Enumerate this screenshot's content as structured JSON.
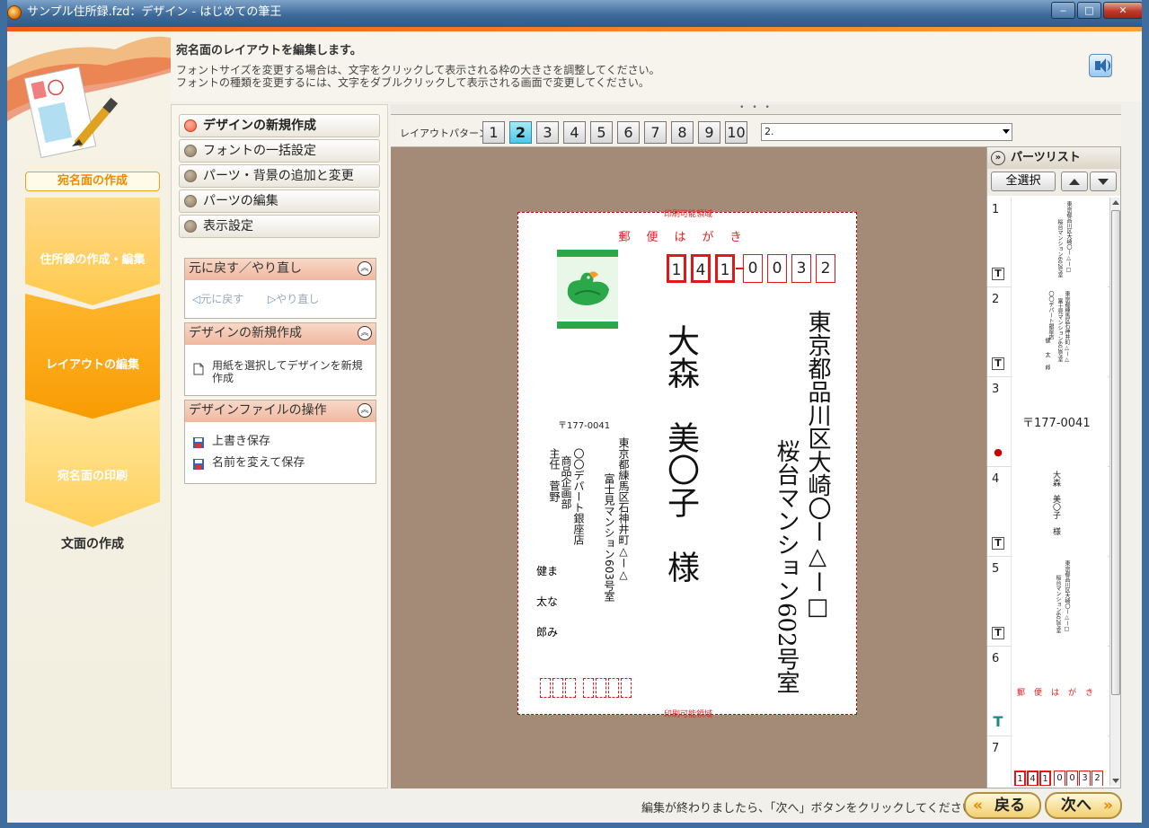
{
  "window": {
    "title": "サンプル住所録.fzd：デザイン - はじめての筆王",
    "controls": {
      "minimize": "‒",
      "maximize": "□",
      "close": "✕"
    }
  },
  "nav": {
    "current_label": "宛名面の作成",
    "items": [
      {
        "label": "住所録の作成・編集"
      },
      {
        "label": "レイアウトの編集"
      },
      {
        "label": "宛名面の印刷"
      },
      {
        "label": "文面の作成"
      }
    ]
  },
  "header": {
    "title": "宛名面のレイアウトを編集します。",
    "line1": "フォントサイズを変更する場合は、文字をクリックして表示される枠の大きさを調整してください。",
    "line2": "フォントの種類を変更するには、文字をダブルクリックして表示される画面で変更してください。"
  },
  "menu": {
    "items": [
      {
        "label": "デザインの新規作成"
      },
      {
        "label": "フォントの一括設定"
      },
      {
        "label": "パーツ・背景の追加と変更"
      },
      {
        "label": "パーツの編集"
      },
      {
        "label": "表示設定"
      }
    ]
  },
  "undo_box": {
    "title": "元に戻す／やり直し",
    "undo": "元に戻す",
    "redo": "やり直し"
  },
  "new_box": {
    "title": "デザインの新規作成",
    "item": "用紙を選択してデザインを新規作成"
  },
  "file_box": {
    "title": "デザインファイルの操作",
    "overwrite": "上書き保存",
    "save_as": "名前を変えて保存"
  },
  "layout": {
    "label": "レイアウトパターン",
    "buttons": [
      "1",
      "2",
      "3",
      "4",
      "5",
      "6",
      "7",
      "8",
      "9",
      "10"
    ],
    "selected": "2",
    "dropdown_value": "2."
  },
  "card": {
    "print_area_label": "印刷可能領域",
    "hagaki": "郵便はがき",
    "zip_digits": [
      "1",
      "4",
      "1",
      "0",
      "0",
      "3",
      "2"
    ],
    "address_line1": "東京都品川区大崎〇ー△ー□",
    "address_line2": "桜台マンション602号室",
    "recipient_name": "大森　美〇子　様",
    "sender_zip": "〒177-0041",
    "sender_address1": "東京都練馬区石神井町△ー△",
    "sender_address2": "富士見マンション603号室",
    "sender_company": "〇〇デパート銀座店",
    "sender_dept": "商品企画部",
    "sender_title": "主任",
    "sender_name": "菅野",
    "family": [
      "健",
      "太",
      "郎"
    ],
    "family2": [
      "ま",
      "な",
      "み"
    ]
  },
  "parts": {
    "title": "パーツリスト",
    "select_all": "全選択",
    "items": [
      {
        "num": "1"
      },
      {
        "num": "2"
      },
      {
        "num": "3",
        "preview": "〒177-0041"
      },
      {
        "num": "4"
      },
      {
        "num": "5"
      },
      {
        "num": "6"
      },
      {
        "num": "7"
      }
    ]
  },
  "footer": {
    "message": "編集が終わりましたら、「次へ」ボタンをクリックしてください。",
    "back": "戻る",
    "next": "次へ"
  },
  "colors": {
    "accent": "#f89a00",
    "selected": "#4bc8e8",
    "red": "#e01818",
    "canvas_bg": "#a38b78"
  }
}
